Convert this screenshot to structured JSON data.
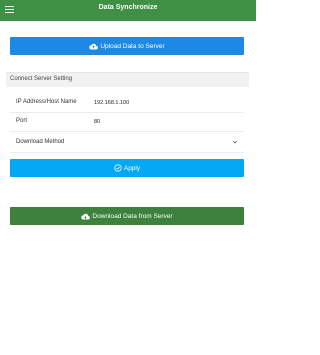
{
  "topbar": {
    "title": "Data Synchronize",
    "menu_icon": "hamburger-menu-icon",
    "color": "#3f8f45"
  },
  "upload": {
    "label": "Upload Data to Server",
    "icon": "cloud-upload-icon",
    "color": "#1e88e5"
  },
  "settings": {
    "title": "Connect Server Setting",
    "ip": {
      "label": "IP Address/Host Name",
      "value": "192.168.1.100"
    },
    "port": {
      "label": "Port",
      "value": "80"
    },
    "method": {
      "label": "Download Method",
      "icon": "chevron-down-icon"
    }
  },
  "apply": {
    "label": "Apply",
    "icon": "check-circle-icon",
    "color": "#03a9f4"
  },
  "download": {
    "label": "Download Data from Server",
    "icon": "cloud-download-icon",
    "color": "#3c823c"
  }
}
